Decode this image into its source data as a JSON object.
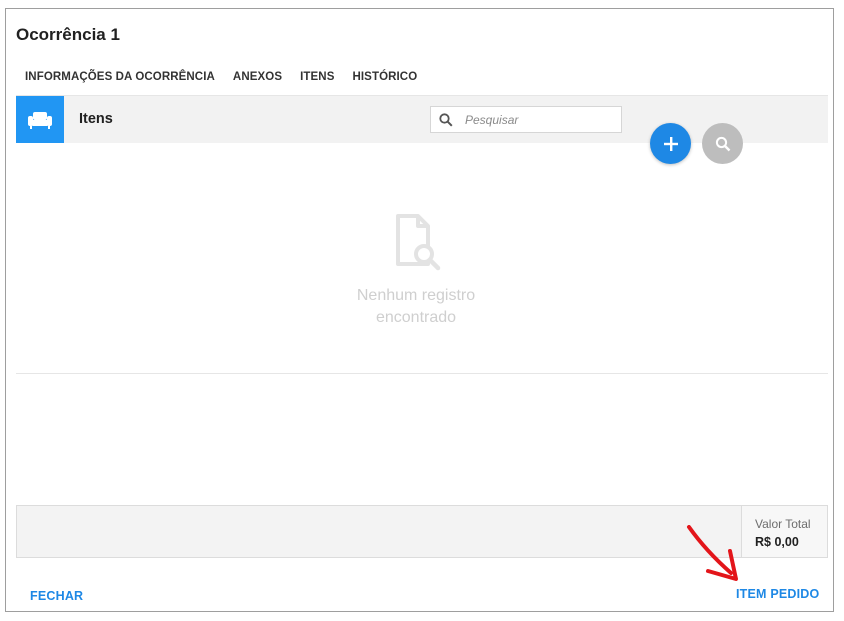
{
  "dialog": {
    "title": "Ocorrência 1"
  },
  "tabs": [
    {
      "label": "INFORMAÇÕES DA OCORRÊNCIA"
    },
    {
      "label": "ANEXOS"
    },
    {
      "label": "ITENS"
    },
    {
      "label": "HISTÓRICO"
    }
  ],
  "active_tab": "ITENS",
  "items_section": {
    "label": "Itens",
    "icon": "sofa-icon",
    "search": {
      "placeholder": "Pesquisar",
      "value": ""
    }
  },
  "actions": {
    "add_icon": "plus-icon",
    "search_icon": "search-icon"
  },
  "empty_state": {
    "icon": "document-search-icon",
    "line1": "Nenhum registro",
    "line2": "encontrado"
  },
  "footer": {
    "total_label": "Valor Total",
    "total_value": "R$ 0,00"
  },
  "buttons": {
    "close_label": "FECHAR",
    "item_label": "ITEM PEDIDO"
  },
  "colors": {
    "accent": "#1e88e5",
    "annotation_arrow": "#e3151a",
    "disabled_fab": "#bdbdbd"
  }
}
